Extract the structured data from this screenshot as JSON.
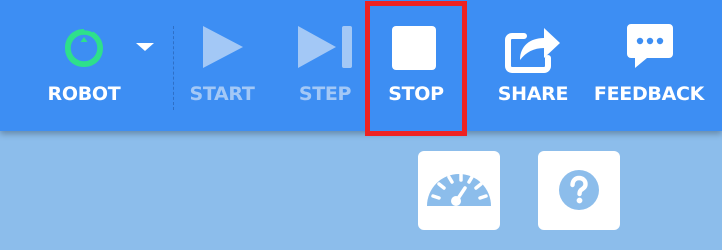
{
  "toolbar": {
    "robot_label": "ROBOT",
    "start_label": "START",
    "step_label": "STEP",
    "stop_label": "STOP",
    "share_label": "SHARE",
    "feedback_label": "FEEDBACK"
  },
  "icons": {
    "robot": "robot-icon",
    "dropdown": "chevron-down-icon",
    "start": "play-icon",
    "step": "step-icon",
    "stop": "stop-icon",
    "share": "share-icon",
    "feedback": "chat-bubble-icon",
    "speed": "speedometer-icon",
    "help": "help-icon"
  },
  "colors": {
    "toolbar_bg": "#3d8ef3",
    "workspace_bg": "#8cbdeb",
    "robot_accent": "#2ee08b",
    "disabled_text": "#a3c8f6",
    "highlight": "#ee2222"
  }
}
